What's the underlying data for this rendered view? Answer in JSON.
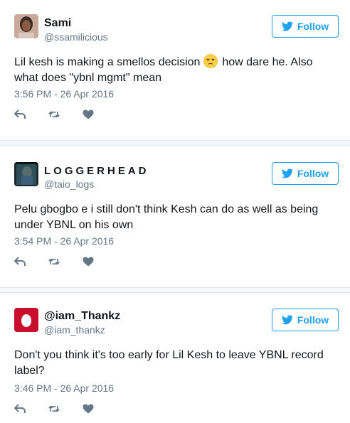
{
  "accent_color": "#1da1f2",
  "tweets": [
    {
      "name": "Sami",
      "handle": "@ssamilicious",
      "follow_label": "Follow",
      "text_before": "Lil kesh is making a smellos decision ",
      "emoji": "unamused-face-emoji",
      "text_after": " how dare he. Also what does \"ybnl mgmt\" mean",
      "timestamp": "3:56 PM - 26 Apr 2016",
      "actions": [
        "reply-icon",
        "retweet-icon",
        "like-icon"
      ]
    },
    {
      "name": "LOGGERHEAD",
      "handle": "@taio_logs",
      "follow_label": "Follow",
      "text": "Pelu gbogbo e i still don't think Kesh can do as well as being under YBNL on his own",
      "timestamp": "3:54 PM - 26 Apr 2016",
      "actions": [
        "reply-icon",
        "retweet-icon",
        "like-icon"
      ]
    },
    {
      "name": "@iam_Thankz",
      "handle": "@iam_thankz",
      "follow_label": "Follow",
      "text": "Don't you think it's too early for Lil Kesh to leave YBNL record label?",
      "timestamp": "3:46 PM - 26 Apr 2016",
      "actions": [
        "reply-icon",
        "retweet-icon",
        "like-icon"
      ]
    }
  ]
}
